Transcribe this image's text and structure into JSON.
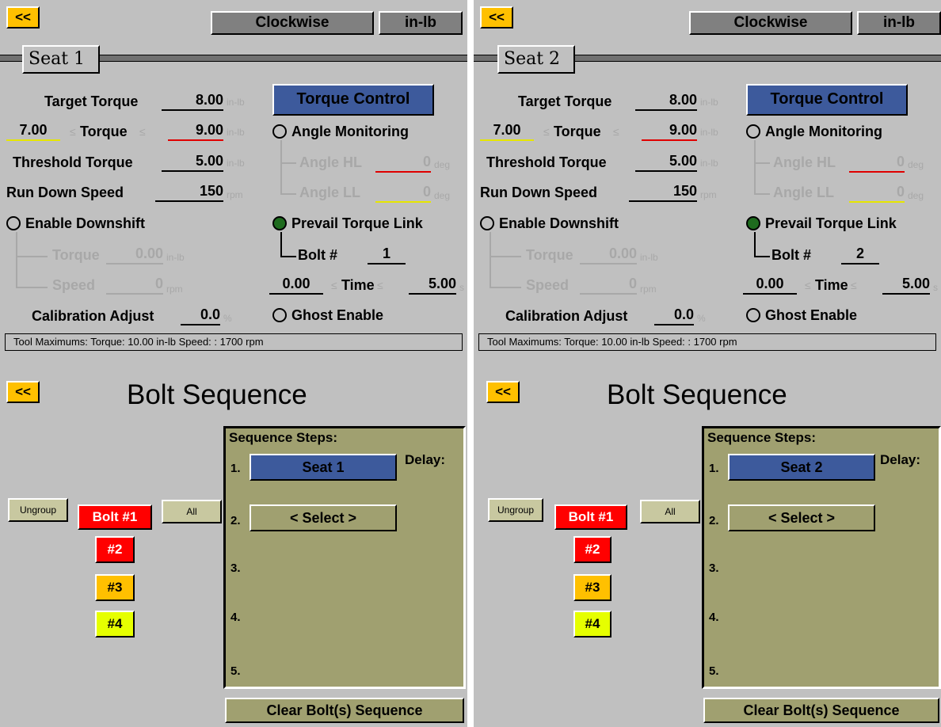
{
  "colors": {
    "back_button": "#ffc000",
    "torque_control": "#3d5a9c",
    "seq_panel": "#a0a070",
    "bolt1": "#ff0000",
    "bolt3": "#ffc000",
    "bolt4": "#e6ff00",
    "radio_on": "#1e6b1e"
  },
  "seat_screens": [
    {
      "back_label": "<<",
      "direction_label": "Clockwise",
      "units_label": "in-lb",
      "seat_tab": "Seat 1",
      "target_torque": {
        "label": "Target Torque",
        "value": "8.00",
        "unit": "in-lb"
      },
      "torque_range": {
        "low": "7.00",
        "label": "Torque",
        "high": "9.00",
        "unit": "in-lb",
        "le": "≤"
      },
      "threshold_torque": {
        "label": "Threshold Torque",
        "value": "5.00",
        "unit": "in-lb"
      },
      "run_down_speed": {
        "label": "Run Down Speed",
        "value": "150",
        "unit": "rpm"
      },
      "enable_downshift": {
        "label": "Enable Downshift",
        "torque_label": "Torque",
        "torque_value": "0.00",
        "torque_unit": "in-lb",
        "speed_label": "Speed",
        "speed_value": "0",
        "speed_unit": "rpm"
      },
      "calibration": {
        "label": "Calibration Adjust",
        "value": "0.0",
        "unit": "%"
      },
      "torque_control_label": "Torque Control",
      "angle_monitoring": {
        "label": "Angle Monitoring",
        "hl_label": "Angle HL",
        "hl_value": "0",
        "ll_label": "Angle LL",
        "ll_value": "0",
        "unit": "deg"
      },
      "prevail": {
        "label": "Prevail Torque Link",
        "bolt_label": "Bolt #",
        "bolt_value": "1"
      },
      "time_range": {
        "low": "0.00",
        "label": "Time",
        "high": "5.00",
        "unit": "s",
        "le": "≤"
      },
      "ghost_label": "Ghost Enable",
      "status": "Tool Maximums:  Torque: 10.00  in-lb Speed: : 1700  rpm"
    },
    {
      "back_label": "<<",
      "direction_label": "Clockwise",
      "units_label": "in-lb",
      "seat_tab": "Seat 2",
      "target_torque": {
        "label": "Target Torque",
        "value": "8.00",
        "unit": "in-lb"
      },
      "torque_range": {
        "low": "7.00",
        "label": "Torque",
        "high": "9.00",
        "unit": "in-lb",
        "le": "≤"
      },
      "threshold_torque": {
        "label": "Threshold Torque",
        "value": "5.00",
        "unit": "in-lb"
      },
      "run_down_speed": {
        "label": "Run Down Speed",
        "value": "150",
        "unit": "rpm"
      },
      "enable_downshift": {
        "label": "Enable Downshift",
        "torque_label": "Torque",
        "torque_value": "0.00",
        "torque_unit": "in-lb",
        "speed_label": "Speed",
        "speed_value": "0",
        "speed_unit": "rpm"
      },
      "calibration": {
        "label": "Calibration Adjust",
        "value": "0.0",
        "unit": "%"
      },
      "torque_control_label": "Torque Control",
      "angle_monitoring": {
        "label": "Angle Monitoring",
        "hl_label": "Angle HL",
        "hl_value": "0",
        "ll_label": "Angle LL",
        "ll_value": "0",
        "unit": "deg"
      },
      "prevail": {
        "label": "Prevail Torque Link",
        "bolt_label": "Bolt #",
        "bolt_value": "2"
      },
      "time_range": {
        "low": "0.00",
        "label": "Time",
        "high": "5.00",
        "unit": "s",
        "le": "≤"
      },
      "ghost_label": "Ghost Enable",
      "status": "Tool Maximums:  Torque: 10.00  in-lb Speed: : 1700  rpm"
    }
  ],
  "sequence_screens": [
    {
      "back_label": "<<",
      "title": "Bolt Sequence",
      "ungroup_label": "Ungroup",
      "all_label": "All",
      "bolts": [
        "Bolt #1",
        "#2",
        "#3",
        "#4"
      ],
      "steps_title": "Sequence Steps:",
      "delay_label": "Delay:",
      "steps": [
        {
          "num": "1.",
          "value": "Seat 1"
        },
        {
          "num": "2.",
          "value": "< Select >"
        },
        {
          "num": "3.",
          "value": ""
        },
        {
          "num": "4.",
          "value": ""
        },
        {
          "num": "5.",
          "value": ""
        }
      ],
      "clear_label": "Clear Bolt(s) Sequence"
    },
    {
      "back_label": "<<",
      "title": "Bolt Sequence",
      "ungroup_label": "Ungroup",
      "all_label": "All",
      "bolts": [
        "Bolt #1",
        "#2",
        "#3",
        "#4"
      ],
      "steps_title": "Sequence Steps:",
      "delay_label": "Delay:",
      "steps": [
        {
          "num": "1.",
          "value": "Seat 2"
        },
        {
          "num": "2.",
          "value": "< Select >"
        },
        {
          "num": "3.",
          "value": ""
        },
        {
          "num": "4.",
          "value": ""
        },
        {
          "num": "5.",
          "value": ""
        }
      ],
      "clear_label": "Clear Bolt(s) Sequence"
    }
  ]
}
